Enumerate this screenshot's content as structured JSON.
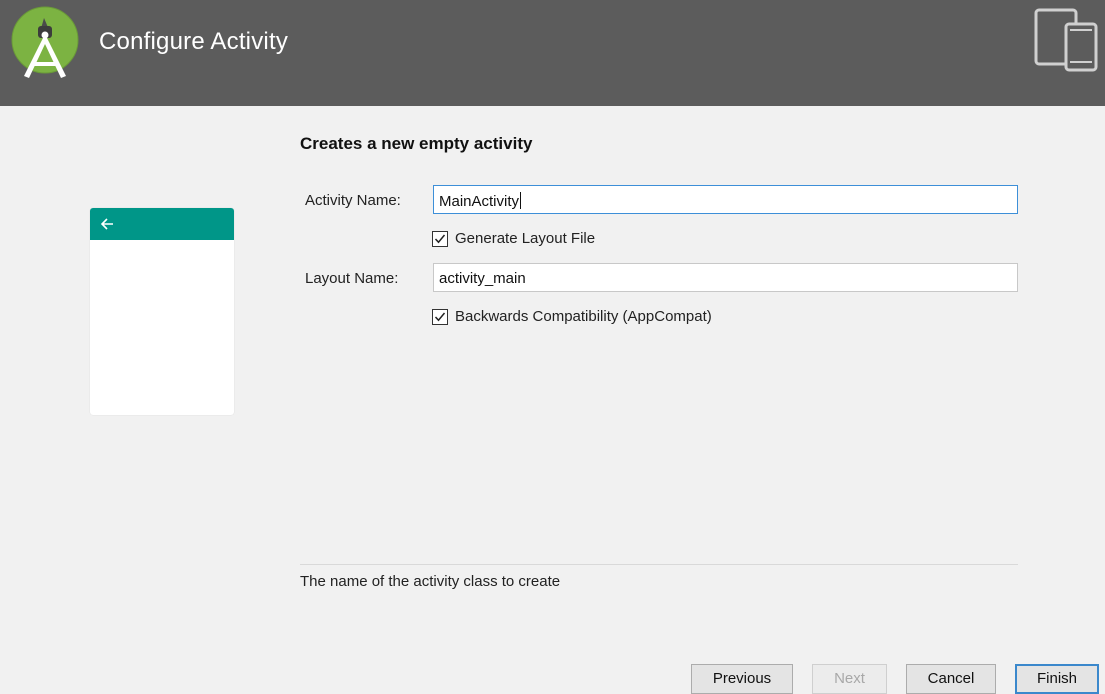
{
  "header": {
    "title": "Configure Activity",
    "logo_icon": "android-studio-logo-icon",
    "device_icon": "tablet-phone-icon",
    "background": "#5c5c5c"
  },
  "main": {
    "heading": "Creates a new empty activity",
    "preview": {
      "appbar_color": "#009688",
      "back_icon": "back-arrow-icon"
    },
    "form": {
      "activity_name_label": "Activity Name:",
      "activity_name_value": "MainActivity",
      "generate_layout_label": "Generate Layout File",
      "generate_layout_checked": true,
      "layout_name_label": "Layout Name:",
      "layout_name_value": "activity_main",
      "backwards_compat_label": "Backwards Compatibility (AppCompat)",
      "backwards_compat_checked": true
    },
    "help_text": "The name of the activity class to create"
  },
  "footer": {
    "previous_label": "Previous",
    "next_label": "Next",
    "cancel_label": "Cancel",
    "finish_label": "Finish",
    "accent": "#3b88cc"
  }
}
